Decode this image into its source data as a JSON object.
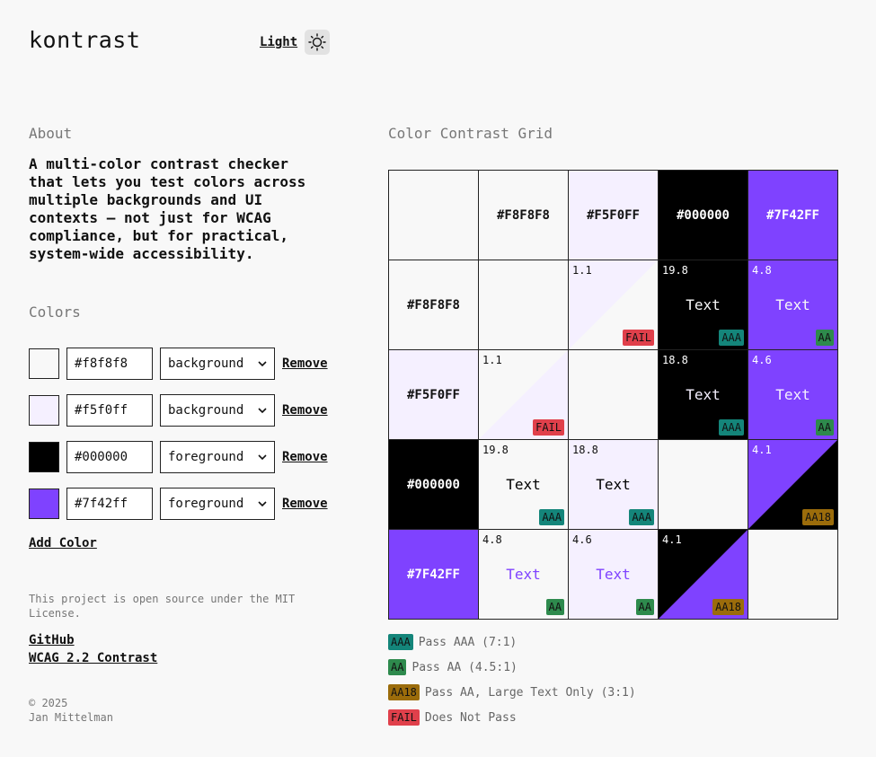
{
  "header": {
    "logo": "kontrast",
    "theme_label": "Light"
  },
  "about": {
    "heading": "About",
    "text": "A multi-color contrast checker that lets you test colors across multiple backgrounds and UI contexts — not just for WCAG compliance, but for practical, system-wide accessibility."
  },
  "colors_section": {
    "heading": "Colors",
    "add_label": "Add Color",
    "remove_label": "Remove",
    "items": [
      {
        "hex": "#f8f8f8",
        "role": "background"
      },
      {
        "hex": "#f5f0ff",
        "role": "background"
      },
      {
        "hex": "#000000",
        "role": "foreground"
      },
      {
        "hex": "#7f42ff",
        "role": "foreground"
      }
    ]
  },
  "footer": {
    "license": "This project is open source under the MIT License.",
    "github": "GitHub",
    "wcag": "WCAG 2.2 Contrast",
    "copyright": "© 2025",
    "author": "Jan Mittelman"
  },
  "grid": {
    "heading": "Color Contrast Grid",
    "sample_text": "Text",
    "colors": [
      {
        "label": "#F8F8F8",
        "hex": "#f8f8f8"
      },
      {
        "label": "#F5F0FF",
        "hex": "#f5f0ff"
      },
      {
        "label": "#000000",
        "hex": "#000000"
      },
      {
        "label": "#7F42FF",
        "hex": "#7f42ff"
      }
    ],
    "cells": [
      [
        null,
        {
          "ratio": "1.1",
          "badge": "FAIL",
          "mode": "fail"
        },
        {
          "ratio": "19.8",
          "badge": "AAA",
          "mode": "text"
        },
        {
          "ratio": "4.8",
          "badge": "AA",
          "mode": "text"
        }
      ],
      [
        {
          "ratio": "1.1",
          "badge": "FAIL",
          "mode": "fail"
        },
        null,
        {
          "ratio": "18.8",
          "badge": "AAA",
          "mode": "text"
        },
        {
          "ratio": "4.6",
          "badge": "AA",
          "mode": "text"
        }
      ],
      [
        {
          "ratio": "19.8",
          "badge": "AAA",
          "mode": "text"
        },
        {
          "ratio": "18.8",
          "badge": "AAA",
          "mode": "text"
        },
        null,
        {
          "ratio": "4.1",
          "badge": "AA18",
          "mode": "large"
        }
      ],
      [
        {
          "ratio": "4.8",
          "badge": "AA",
          "mode": "text"
        },
        {
          "ratio": "4.6",
          "badge": "AA",
          "mode": "text"
        },
        {
          "ratio": "4.1",
          "badge": "AA18",
          "mode": "large"
        },
        null
      ]
    ]
  },
  "badge_colors": {
    "AAA": "#14857a",
    "AA": "#2e8a4d",
    "AA18": "#9b6c0b",
    "FAIL": "#e0404b"
  },
  "legend": [
    {
      "badge": "AAA",
      "text": "Pass AAA (7:1)"
    },
    {
      "badge": "AA",
      "text": "Pass AA (4.5:1)"
    },
    {
      "badge": "AA18",
      "text": "Pass AA, Large Text Only (3:1)"
    },
    {
      "badge": "FAIL",
      "text": "Does Not Pass"
    }
  ]
}
